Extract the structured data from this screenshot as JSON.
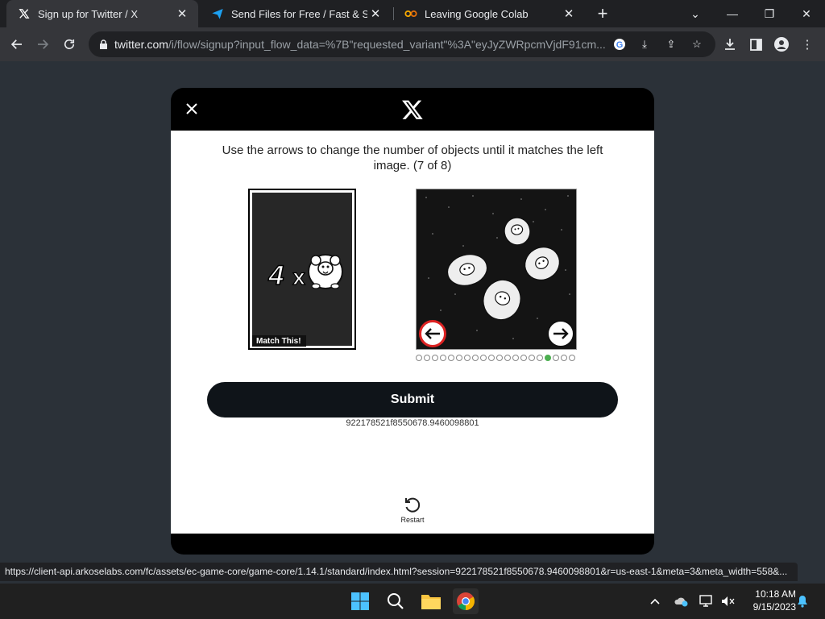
{
  "browser": {
    "tabs": [
      {
        "title": "Sign up for Twitter / X",
        "icon": "x-logo-icon",
        "active": true
      },
      {
        "title": "Send Files for Free / Fast & Secur",
        "icon": "paper-plane-icon",
        "active": false
      },
      {
        "title": "Leaving Google Colab",
        "icon": "colab-icon",
        "active": false
      }
    ],
    "url_host": "twitter.com",
    "url_rest": "/i/flow/signup?input_flow_data=%7B\"requested_variant\"%3A\"eyJyZWRpcmVjdF91cm..."
  },
  "modal": {
    "instruction": "Use the arrows to change the number of objects until it matches the left image. (7 of 8)",
    "match_count": "4",
    "match_x": "x",
    "match_label": "Match This!",
    "dots_total": 20,
    "dots_active_index": 16,
    "submit_label": "Submit",
    "session_id": "922178521f8550678.9460098801",
    "restart_label": "Restart"
  },
  "status_url": "https://client-api.arkoselabs.com/fc/assets/ec-game-core/game-core/1.14.1/standard/index.html?session=922178521f8550678.9460098801&r=us-east-1&meta=3&meta_width=558&...",
  "taskbar": {
    "time": "10:18 AM",
    "date": "9/15/2023"
  },
  "colors": {
    "accent_dot": "#4caf50",
    "submit_bg": "#0f1419",
    "page_bg": "#2b3138"
  }
}
